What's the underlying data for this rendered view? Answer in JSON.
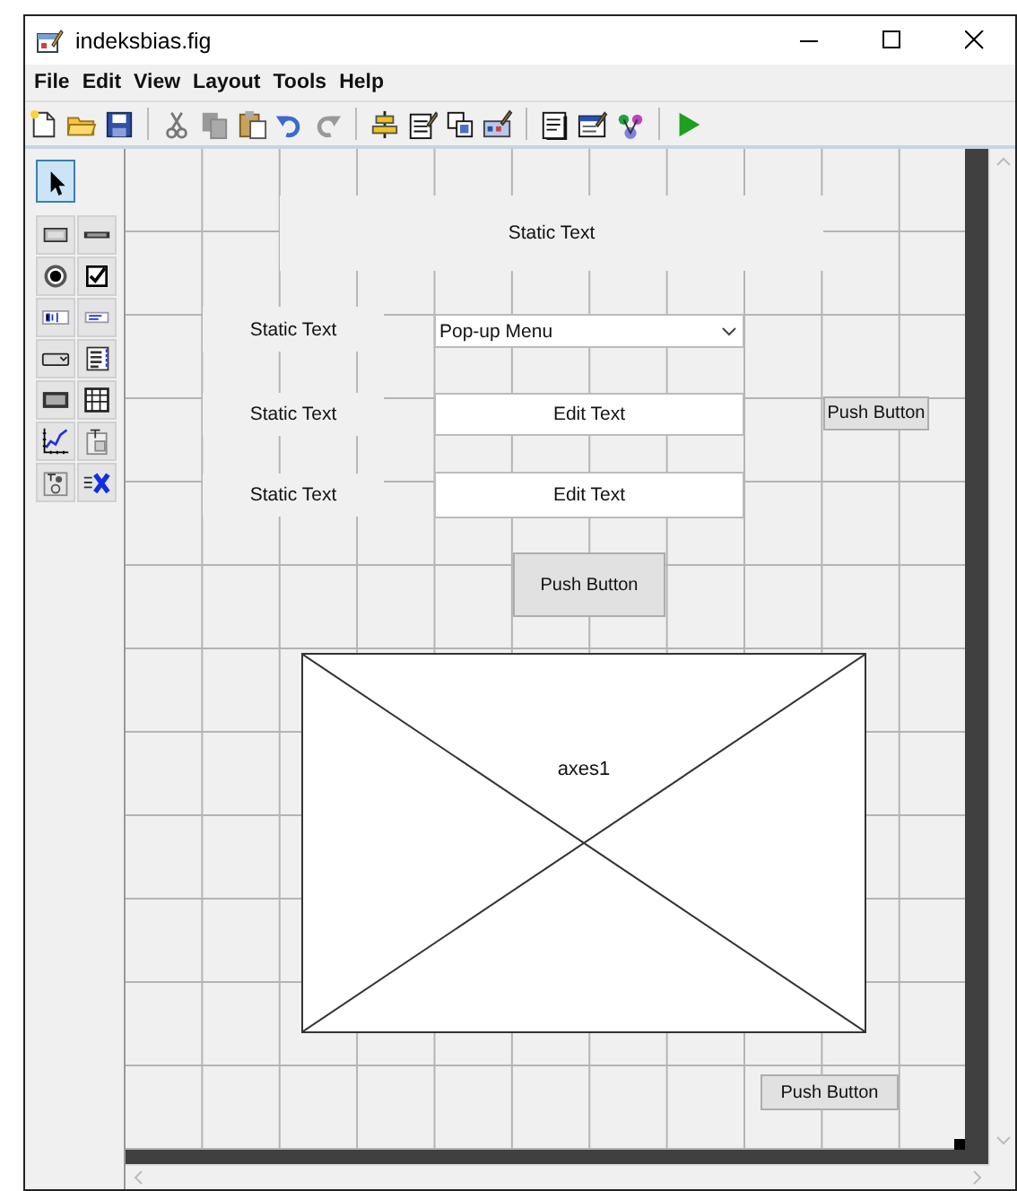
{
  "window": {
    "title": "indeksbias.fig"
  },
  "menu": [
    "File",
    "Edit",
    "View",
    "Layout",
    "Tools",
    "Help"
  ],
  "toolbar": [
    {
      "kind": "new"
    },
    {
      "kind": "open"
    },
    {
      "kind": "save"
    },
    {
      "kind": "sep"
    },
    {
      "kind": "cut"
    },
    {
      "kind": "copy"
    },
    {
      "kind": "paste"
    },
    {
      "kind": "undo"
    },
    {
      "kind": "redo"
    },
    {
      "kind": "sep"
    },
    {
      "kind": "align"
    },
    {
      "kind": "menu_editor"
    },
    {
      "kind": "tab_order"
    },
    {
      "kind": "toolbar_editor"
    },
    {
      "kind": "sep"
    },
    {
      "kind": "editor"
    },
    {
      "kind": "inspector"
    },
    {
      "kind": "browser"
    },
    {
      "kind": "sep"
    },
    {
      "kind": "run"
    }
  ],
  "palette": [
    {
      "kind": "select",
      "selected": true
    },
    {
      "kind": "pushbutton",
      "selected": false
    },
    {
      "kind": "slider",
      "selected": false
    },
    {
      "kind": "radio",
      "selected": false
    },
    {
      "kind": "checkbox",
      "selected": false
    },
    {
      "kind": "edit",
      "selected": false
    },
    {
      "kind": "text",
      "selected": false
    },
    {
      "kind": "popup",
      "selected": false
    },
    {
      "kind": "listbox",
      "selected": false
    },
    {
      "kind": "toggle",
      "selected": false
    },
    {
      "kind": "table",
      "selected": false
    },
    {
      "kind": "axes",
      "selected": false
    },
    {
      "kind": "panel",
      "selected": false
    },
    {
      "kind": "buttongroup",
      "selected": false
    },
    {
      "kind": "activex",
      "selected": false
    }
  ],
  "canvas": {
    "components": [
      {
        "kind": "static_text",
        "text": "Static Text"
      },
      {
        "kind": "static_text",
        "text": "Static Text"
      },
      {
        "kind": "popup",
        "text": "Pop-up Menu"
      },
      {
        "kind": "static_text",
        "text": "Static Text"
      },
      {
        "kind": "edit_text",
        "text": "Edit Text"
      },
      {
        "kind": "push_button",
        "text": "Push Button"
      },
      {
        "kind": "static_text",
        "text": "Static Text"
      },
      {
        "kind": "edit_text",
        "text": "Edit Text"
      },
      {
        "kind": "push_button",
        "text": "Push Button"
      },
      {
        "kind": "axes",
        "text": "axes1"
      },
      {
        "kind": "push_button",
        "text": "Push Button"
      }
    ]
  }
}
